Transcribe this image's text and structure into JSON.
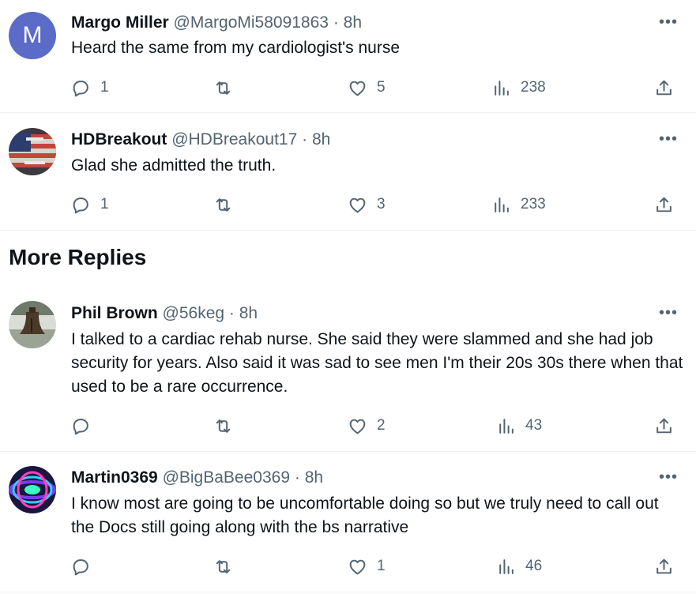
{
  "section_title": "More Replies",
  "tweets": [
    {
      "name": "Margo Miller",
      "handle": "@MargoMi58091863",
      "time": "8h",
      "avatar_letter": "M",
      "text": "Heard the same from my cardiologist's nurse",
      "reply_count": "1",
      "retweet_count": "",
      "like_count": "5",
      "view_count": "238"
    },
    {
      "name": "HDBreakout",
      "handle": "@HDBreakout17",
      "time": "8h",
      "text": "Glad she admitted the truth.",
      "reply_count": "1",
      "retweet_count": "",
      "like_count": "3",
      "view_count": "233"
    },
    {
      "name": "Phil Brown",
      "handle": "@56keg",
      "time": "8h",
      "text": "I talked to a cardiac rehab nurse. She said they were slammed and she had job security for years. Also said it was sad to see men I'm their 20s 30s there when that used to be a rare occurrence.",
      "reply_count": "",
      "retweet_count": "",
      "like_count": "2",
      "view_count": "43"
    },
    {
      "name": "Martin0369",
      "handle": "@BigBaBee0369",
      "time": "8h",
      "text": "I know most are going to be uncomfortable doing so but we truly need to call out the Docs still going along with the bs narrative",
      "reply_count": "",
      "retweet_count": "",
      "like_count": "1",
      "view_count": "46"
    }
  ],
  "separator": "·",
  "more_glyph": "•••",
  "icons": [
    "reply-icon",
    "retweet-icon",
    "like-icon",
    "views-icon",
    "share-icon",
    "more-icon"
  ],
  "colors": {
    "text": "#0f1419",
    "secondary": "#536471",
    "border": "#eff3f4",
    "avatar_m": "#5b6bc7"
  }
}
